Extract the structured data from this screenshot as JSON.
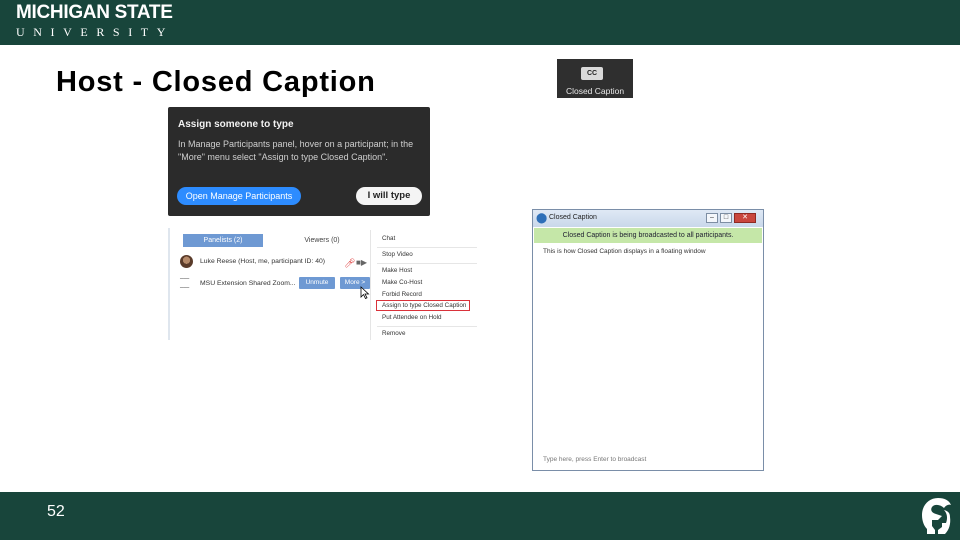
{
  "header": {
    "logo_line1": "MICHIGAN STATE",
    "logo_line2": "UNIVERSITY"
  },
  "slide": {
    "title": "Host - Closed Caption",
    "page_number": "52"
  },
  "cc_button": {
    "icon_text": "CC",
    "label": "Closed Caption"
  },
  "assign_popup": {
    "title": "Assign someone to type",
    "text": "In Manage Participants panel, hover on a participant; in the \"More\" menu select \"Assign to type Closed Caption\".",
    "open_button": "Open Manage Participants",
    "self_button": "I will type"
  },
  "participants": {
    "tabs": [
      "Panelists (2)",
      "Viewers (0)"
    ],
    "rows": [
      {
        "name": "Luke Reese (Host, me, participant ID: 40)"
      },
      {
        "name": "MSU Extension Shared Zoom..."
      }
    ],
    "unmute_label": "Unmute",
    "more_label": "More >",
    "menu": [
      "Chat",
      "Stop Video",
      "Make Host",
      "Make Co-Host",
      "Forbid Record",
      "Assign to type Closed Caption",
      "Put Attendee on Hold",
      "Remove"
    ]
  },
  "cc_window": {
    "title": "Closed Caption",
    "banner": "Closed Caption is being broadcasted to all participants.",
    "body": "This is how Closed Caption displays in a floating window",
    "input_hint": "Type here, press Enter to broadcast"
  }
}
